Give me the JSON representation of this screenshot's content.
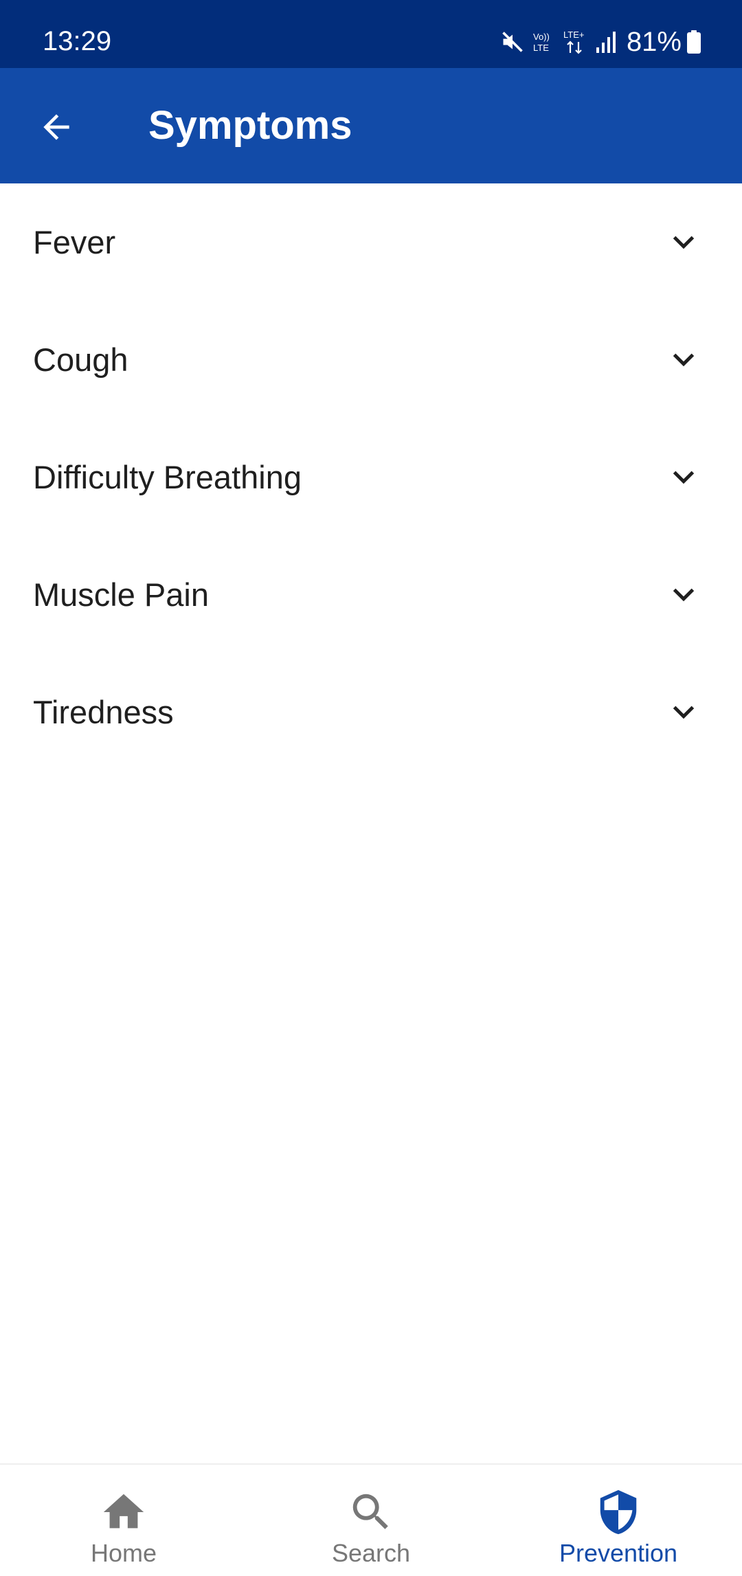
{
  "status_bar": {
    "time": "13:29",
    "battery": "81%"
  },
  "app_bar": {
    "title": "Symptoms"
  },
  "symptoms": [
    {
      "label": "Fever"
    },
    {
      "label": "Cough"
    },
    {
      "label": "Difficulty Breathing"
    },
    {
      "label": "Muscle Pain"
    },
    {
      "label": "Tiredness"
    }
  ],
  "bottom_nav": {
    "items": [
      {
        "label": "Home",
        "icon": "home-icon"
      },
      {
        "label": "Search",
        "icon": "search-icon"
      },
      {
        "label": "Prevention",
        "icon": "shield-icon",
        "active": true
      }
    ]
  },
  "colors": {
    "status_bar": "#022d7b",
    "app_bar": "#124ba8",
    "nav_active": "#124ba8",
    "nav_inactive": "#777777"
  }
}
